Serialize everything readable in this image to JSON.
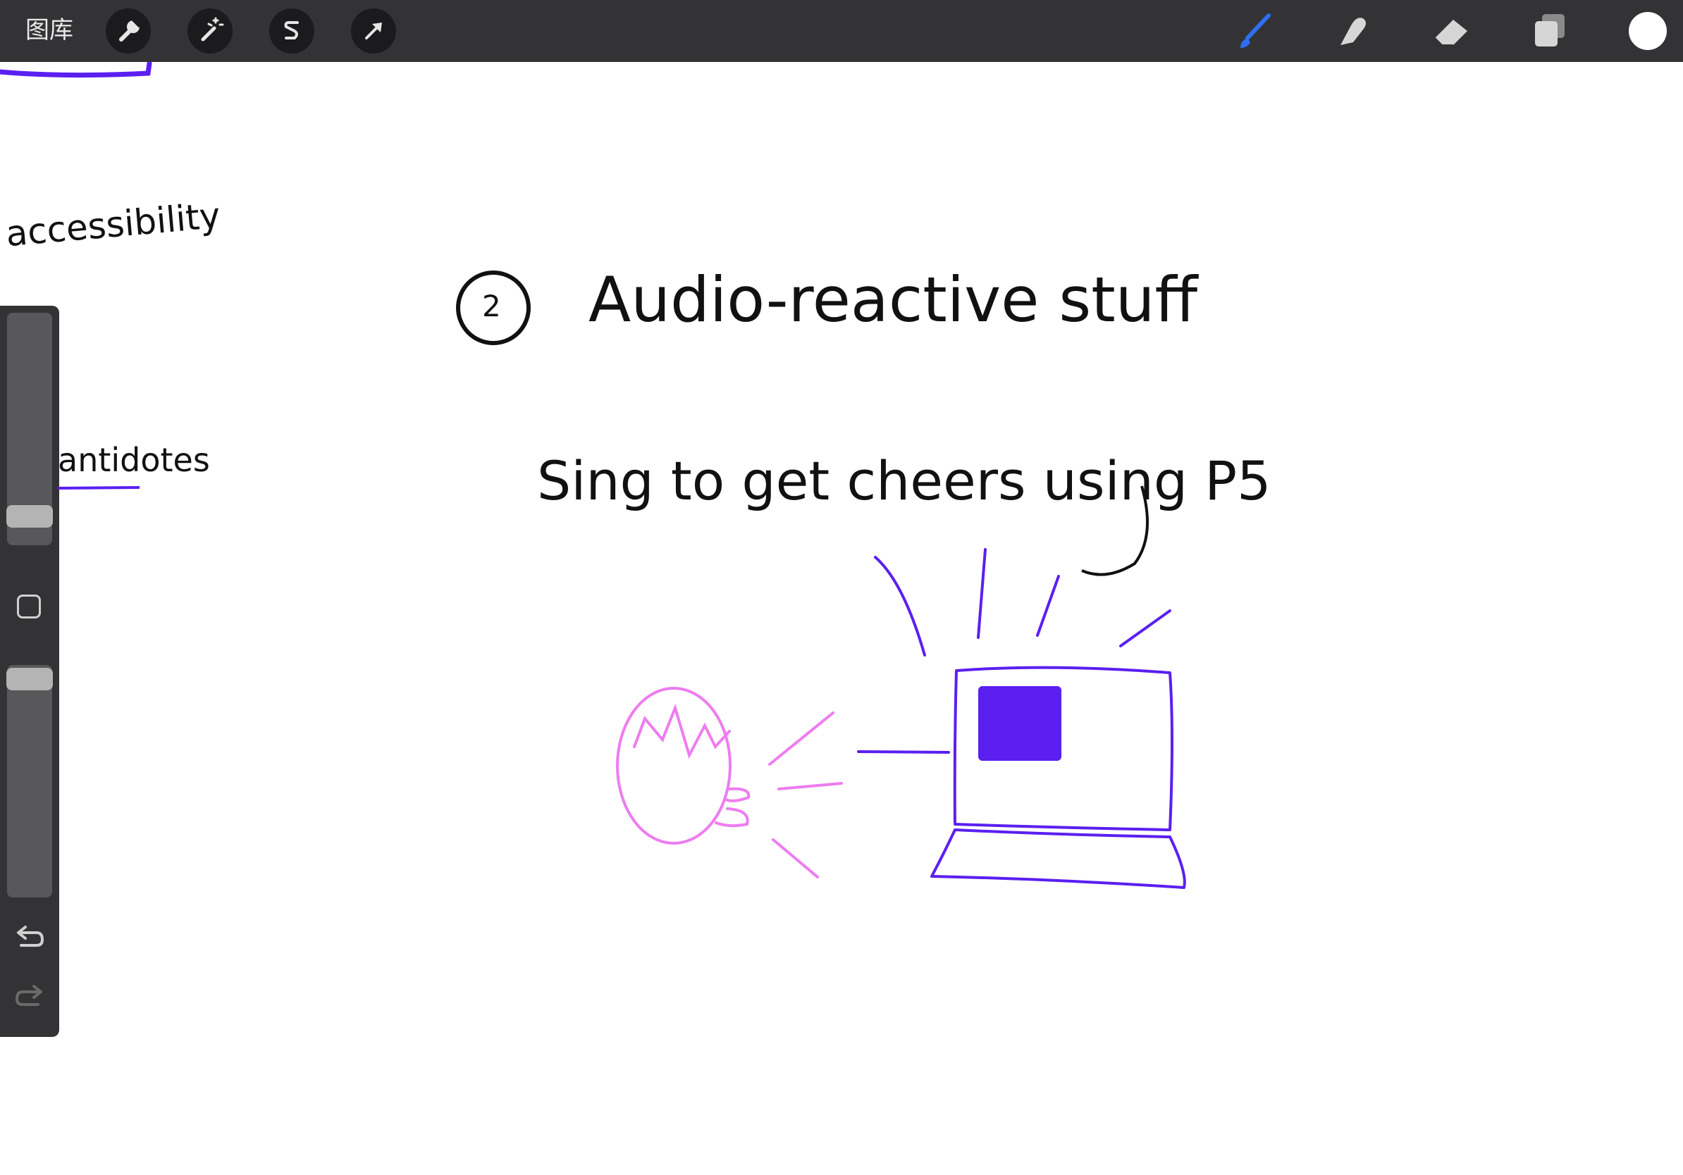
{
  "toolbar": {
    "gallery_label": "图库",
    "left_tools": [
      {
        "name": "actions",
        "icon": "wrench-icon"
      },
      {
        "name": "adjustments",
        "icon": "magic-wand-icon"
      },
      {
        "name": "selection",
        "icon": "selection-s-icon"
      },
      {
        "name": "transform",
        "icon": "arrow-cursor-icon"
      }
    ],
    "right_tools": [
      {
        "name": "brush",
        "icon": "brush-icon",
        "active": true
      },
      {
        "name": "smudge",
        "icon": "smudge-finger-icon",
        "active": false
      },
      {
        "name": "eraser",
        "icon": "eraser-icon",
        "active": false
      },
      {
        "name": "layers",
        "icon": "layers-icon",
        "active": false
      }
    ],
    "current_color": "#ffffff",
    "active_tool_color": "#2f6ef2"
  },
  "sidebar": {
    "brush_size_level": 0.12,
    "opacity_level": 0.95,
    "modify_icon": "square-modify-icon",
    "undo_icon": "undo-icon",
    "redo_icon": "redo-icon"
  },
  "canvas": {
    "notes": {
      "accessibility": "accessibility",
      "antidotes": "antidotes",
      "heading_number": "2",
      "heading": "Audio-reactive stuff",
      "subheading": "Sing to get cheers using P5"
    },
    "ink_colors": {
      "black": "#111111",
      "purple": "#5b1ff0",
      "pink": "#ee7cf0"
    },
    "sketch": {
      "left_figure": "singing-face",
      "right_figure": "laptop-with-cheering-lines"
    }
  }
}
